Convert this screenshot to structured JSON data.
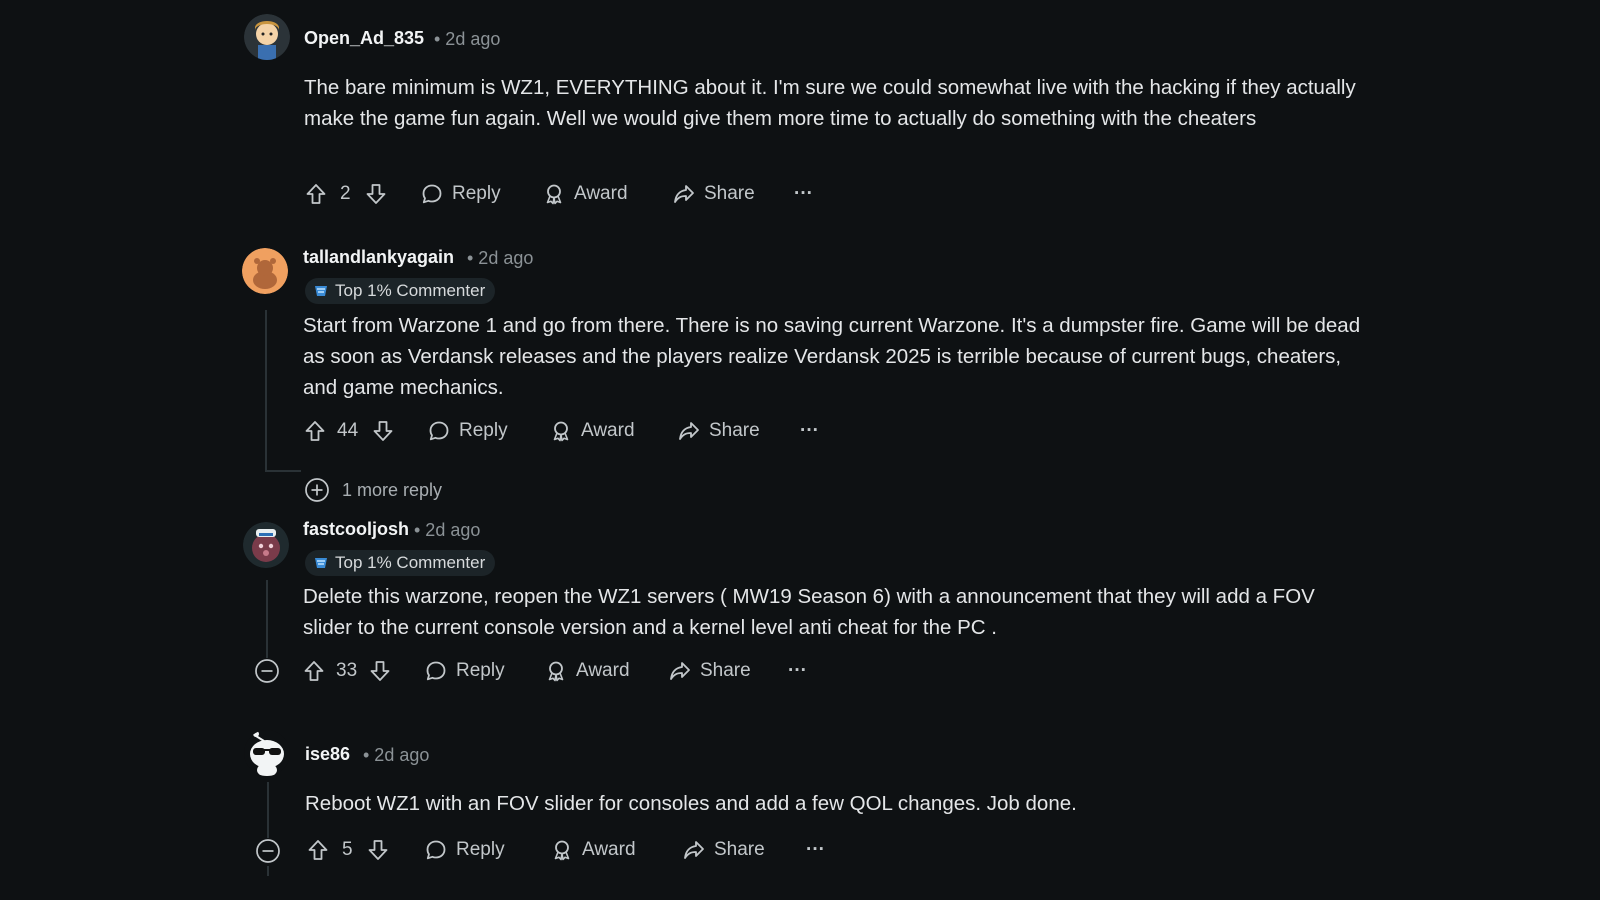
{
  "comments": [
    {
      "author": "Open_Ad_835",
      "time": "• 2d ago",
      "badge": "",
      "body": "The bare minimum is WZ1, EVERYTHING about it. I'm sure we could somewhat live with the hacking if they actually make the game fun again. Well we would give them more time to actually do something with the cheaters",
      "votes": "2",
      "reply": "Reply",
      "award": "Award",
      "share": "Share",
      "more": "···"
    },
    {
      "author": "tallandlankyagain",
      "time": "• 2d ago",
      "badge": "Top 1% Commenter",
      "body": "Start from Warzone 1 and go from there. There is no saving current Warzone. It's a dumpster fire. Game will be dead as soon as Verdansk releases and the players realize Verdansk 2025 is terrible because of current bugs, cheaters, and game mechanics.",
      "votes": "44",
      "reply": "Reply",
      "award": "Award",
      "share": "Share",
      "more": "···",
      "more_replies": "1 more reply"
    },
    {
      "author": "fastcooljosh",
      "time": "• 2d ago",
      "badge": "Top 1% Commenter",
      "body": "Delete this warzone, reopen the WZ1 servers ( MW19 Season 6) with a announcement that they will add a FOV slider to the current console version and a kernel level anti cheat for the PC .",
      "votes": "33",
      "reply": "Reply",
      "award": "Award",
      "share": "Share",
      "more": "···"
    },
    {
      "author": "ise86",
      "time": "• 2d ago",
      "badge": "",
      "body": "Reboot WZ1 with an FOV slider for consoles and add a few QOL changes. Job done.",
      "votes": "5",
      "reply": "Reply",
      "award": "Award",
      "share": "Share",
      "more": "···"
    }
  ],
  "icons": {
    "upvote": "upvote-icon",
    "downvote": "downvote-icon",
    "reply": "comment-bubble-icon",
    "award": "award-icon",
    "share": "share-arrow-icon",
    "more": "more-options-icon",
    "expand": "plus-circle-icon",
    "collapse": "minus-circle-icon",
    "badge": "top-commenter-badge-icon"
  },
  "colors": {
    "background": "#0e1113",
    "text": "#e4e6e8",
    "muted": "#8b9296",
    "badge_bg": "#1c2428"
  }
}
